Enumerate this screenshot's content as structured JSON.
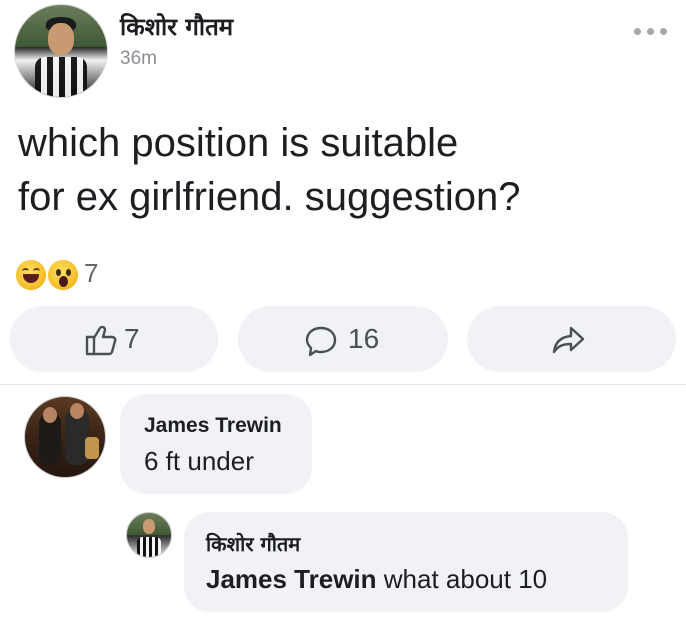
{
  "post": {
    "author": "किशोर गौतम",
    "time": "36m",
    "text_line1": "which position is suitable",
    "text_line2": "for ex girlfriend. suggestion?",
    "reactions": {
      "icons": [
        "laughing-emoji",
        "wow-emoji"
      ],
      "count": "7"
    },
    "actions": {
      "like_count": "7",
      "comment_count": "16"
    }
  },
  "comments": [
    {
      "author": "James Trewin",
      "text": "6 ft under"
    },
    {
      "author": "किशोर गौतम",
      "mention": "James Trewin",
      "text": " what about 10"
    }
  ],
  "colors": {
    "bubble": "#f0f2f5",
    "muted": "#65676b",
    "text": "#1c1e21"
  }
}
